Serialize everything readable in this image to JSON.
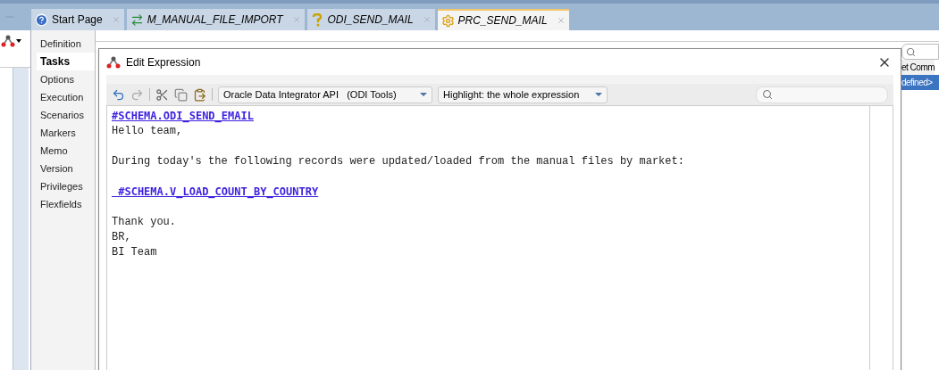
{
  "tabs": [
    {
      "label": "Start Page",
      "kind": "help",
      "selected": false
    },
    {
      "label": "M_MANUAL_FILE_IMPORT",
      "kind": "mapping",
      "selected": false
    },
    {
      "label": "ODI_SEND_MAIL",
      "kind": "variable",
      "selected": false
    },
    {
      "label": "PRC_SEND_MAIL",
      "kind": "procedure",
      "selected": true
    }
  ],
  "side_nav": [
    {
      "label": "Definition",
      "selected": false
    },
    {
      "label": "Tasks",
      "selected": true
    },
    {
      "label": "Options",
      "selected": false
    },
    {
      "label": "Execution",
      "selected": false
    },
    {
      "label": "Scenarios",
      "selected": false
    },
    {
      "label": "Markers",
      "selected": false
    },
    {
      "label": "Memo",
      "selected": false
    },
    {
      "label": "Version",
      "selected": false
    },
    {
      "label": "Privileges",
      "selected": false
    },
    {
      "label": "Flexfields",
      "selected": false
    }
  ],
  "right_panel": {
    "column_header": "et Comm",
    "cell": "defined>"
  },
  "dialog": {
    "title": "Edit Expression",
    "toolbar": {
      "api_dropdown": "Oracle Data Integrator API   (ODI Tools)",
      "highlight_dropdown": "Highlight: the whole expression"
    },
    "lines": [
      {
        "kind": "link",
        "text": "#SCHEMA.ODI_SEND_EMAIL"
      },
      {
        "kind": "text",
        "text": "Hello team,"
      },
      {
        "kind": "blank"
      },
      {
        "kind": "text",
        "text": "During today's the following records were updated/loaded from the manual files by market:"
      },
      {
        "kind": "blank"
      },
      {
        "kind": "link",
        "text": " #SCHEMA.V_LOAD_COUNT_BY_COUNTRY"
      },
      {
        "kind": "blank"
      },
      {
        "kind": "text",
        "text": "Thank you."
      },
      {
        "kind": "text",
        "text": "BR,"
      },
      {
        "kind": "text",
        "text": "BI Team"
      }
    ]
  }
}
